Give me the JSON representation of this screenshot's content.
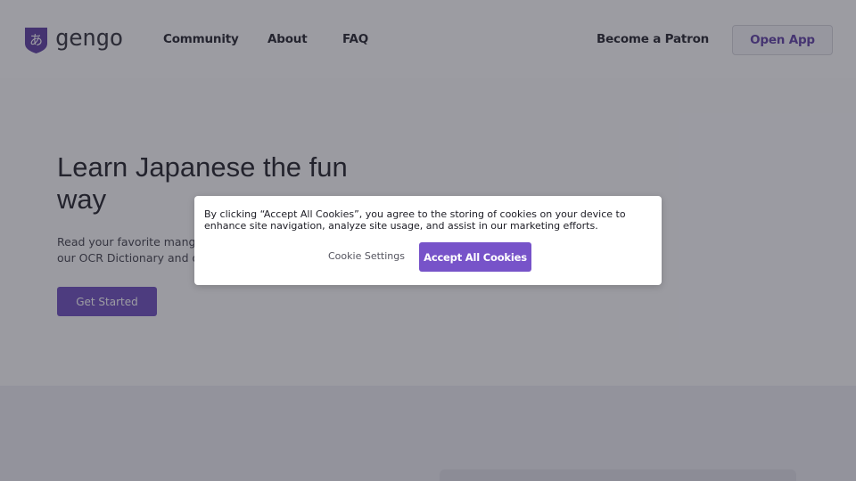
{
  "header": {
    "logo_glyph": "あ",
    "logo_text": "gengo",
    "nav": [
      {
        "label": "Community"
      },
      {
        "label": "About"
      },
      {
        "label": "FAQ"
      }
    ],
    "patron_label": "Become a Patron",
    "open_app_label": "Open App"
  },
  "hero": {
    "title": "Learn Japanese the fun way",
    "subtitle": "Read your favorite manga a... our OCR Dictionary and oth...",
    "subtitle_line1": "Read your favorite manga a",
    "subtitle_line2": "our OCR Dictionary and oth",
    "cta_label": "Get Started"
  },
  "cookie_banner": {
    "text": "By clicking “Accept All Cookies”, you agree to the storing of cookies on your device to enhance site navigation, analyze site usage, and assist in our marketing efforts.",
    "settings_label": "Cookie Settings",
    "accept_label": "Accept All Cookies"
  },
  "colors": {
    "brand_purple": "#6b4bbe",
    "accept_purple": "#7753c9",
    "logo_purple": "#5a3aa0"
  }
}
